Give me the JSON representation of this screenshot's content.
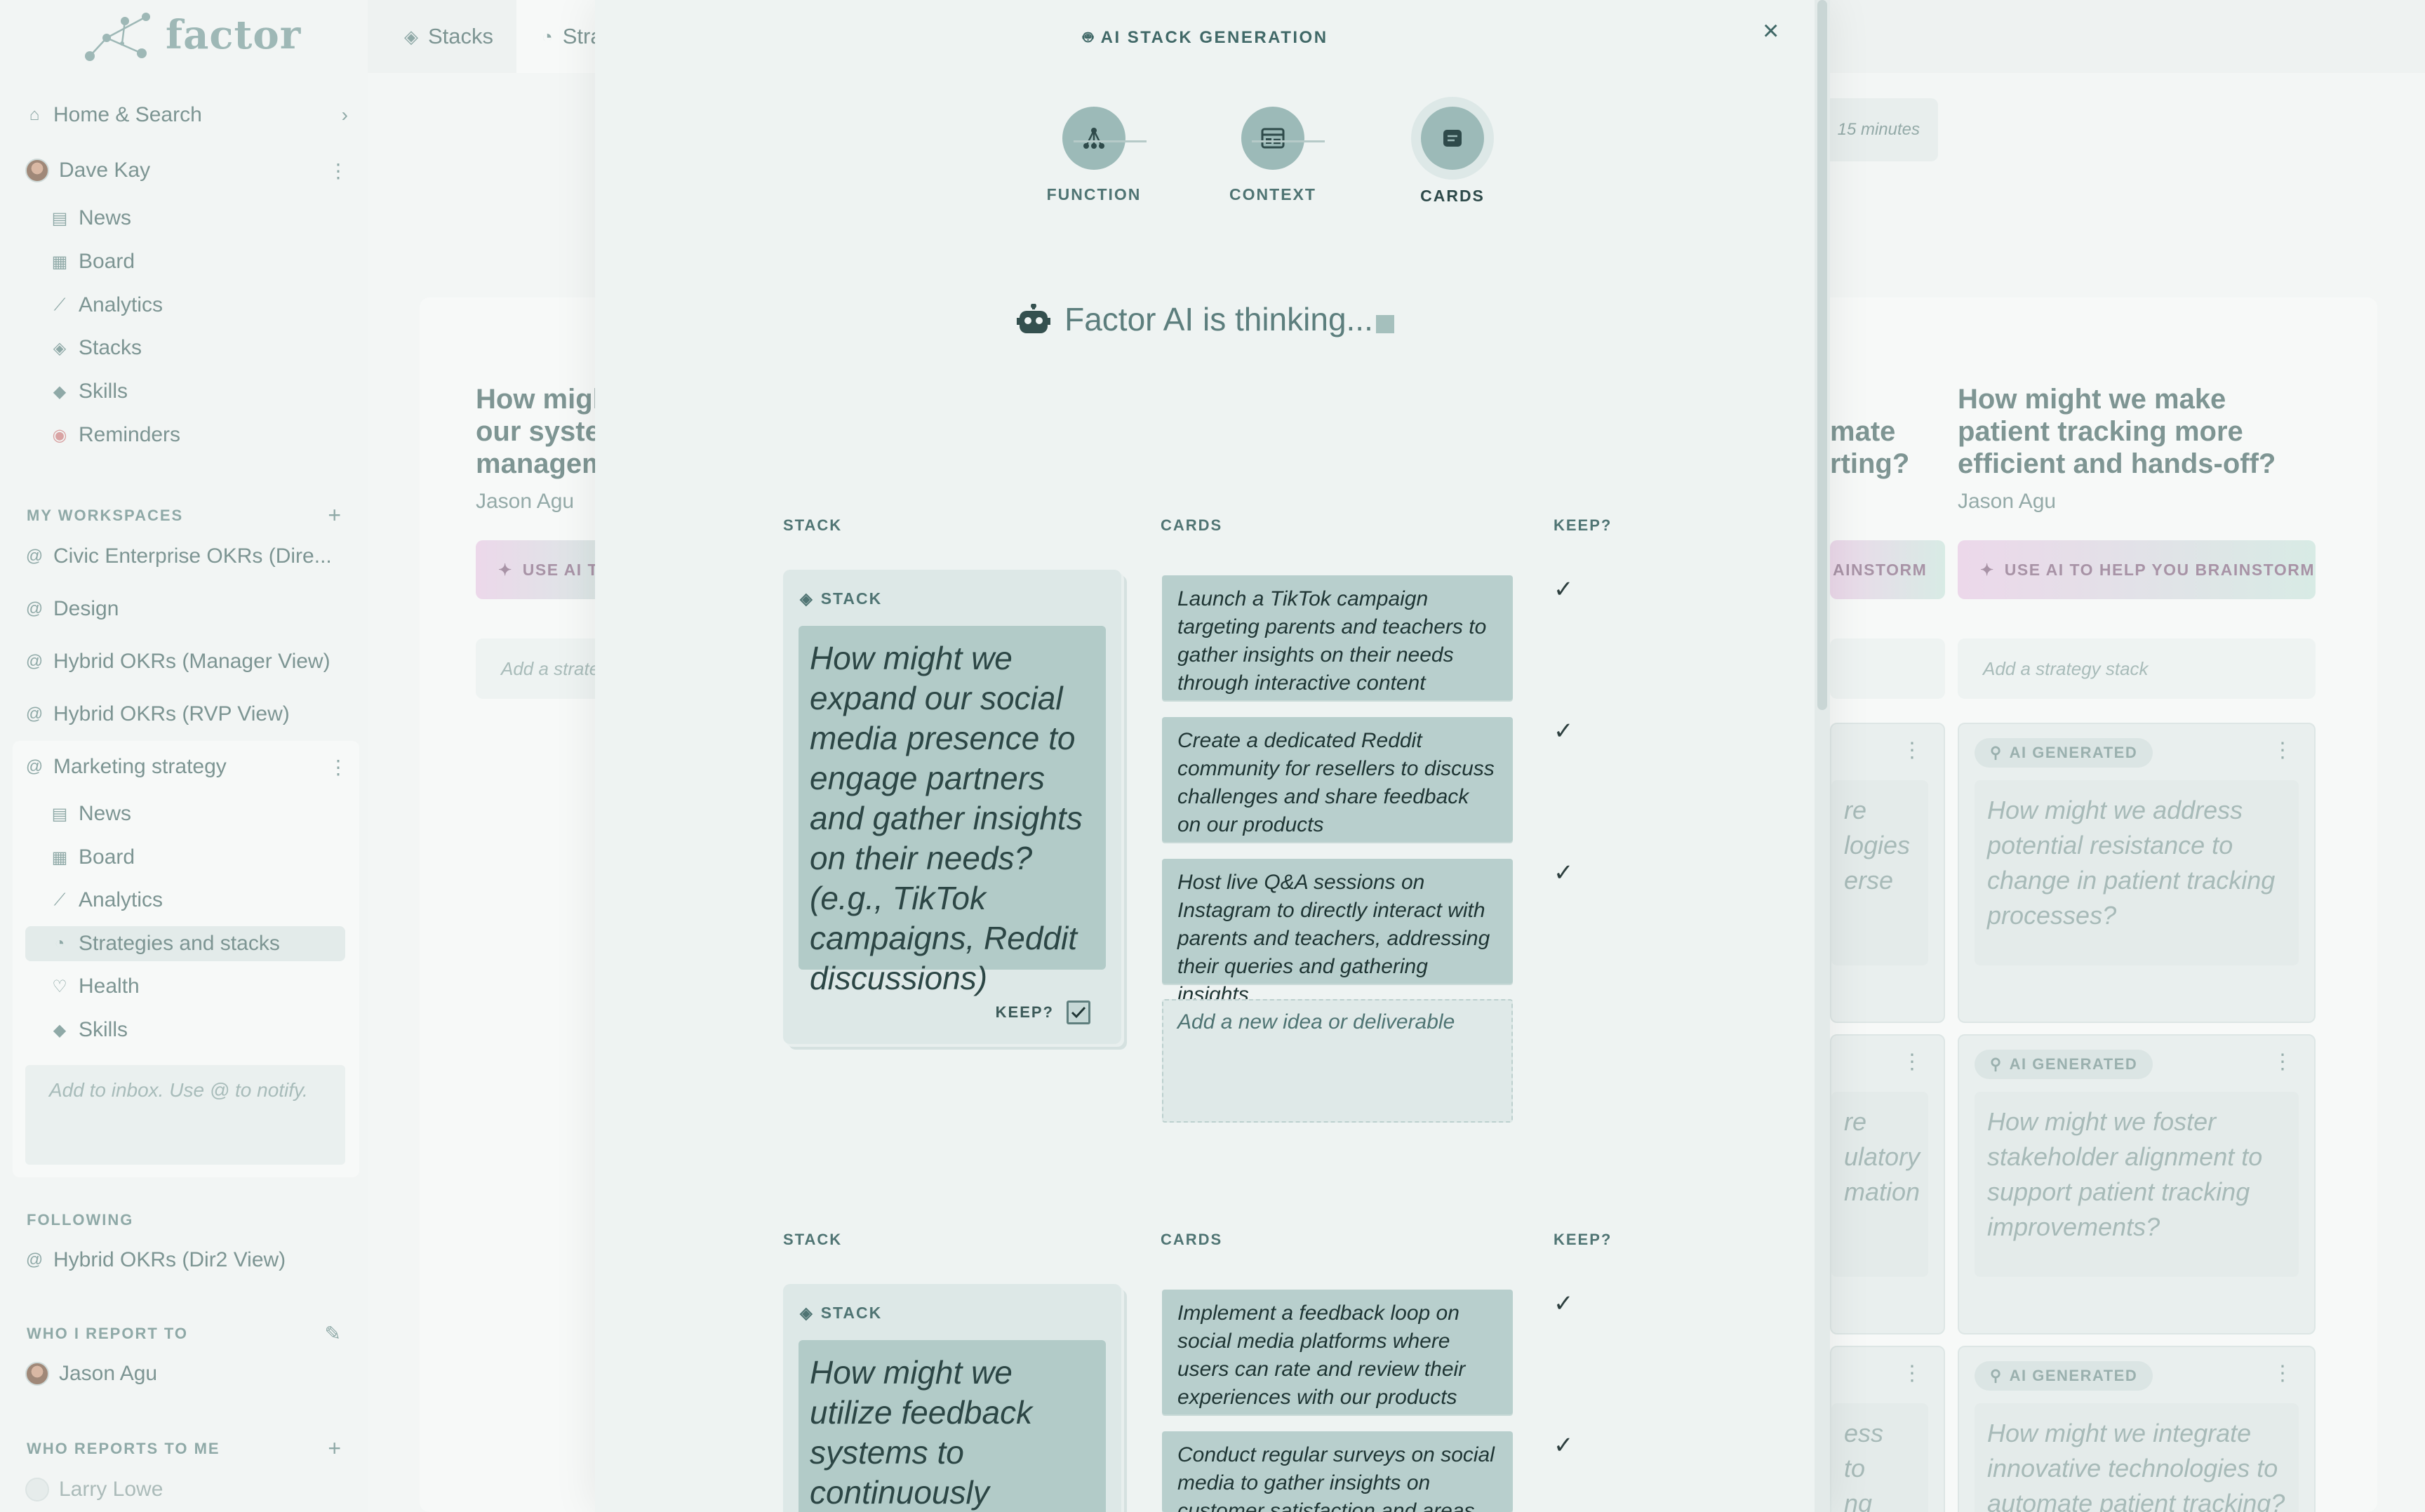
{
  "app": {
    "name": "factor"
  },
  "sidebar": {
    "home": "Home & Search",
    "user": "Dave Kay",
    "user_items": [
      "News",
      "Board",
      "Analytics",
      "Stacks",
      "Skills",
      "Reminders"
    ],
    "my_workspaces_label": "MY WORKSPACES",
    "workspaces": [
      "Civic Enterprise OKRs (Dire...",
      "Design",
      "Hybrid OKRs (Manager View)",
      "Hybrid OKRs (RVP View)",
      "Marketing strategy"
    ],
    "workspace_items": [
      "News",
      "Board",
      "Analytics",
      "Strategies and stacks",
      "Health",
      "Skills"
    ],
    "inbox_placeholder": "Add to inbox. Use @ to notify.",
    "following_label": "FOLLOWING",
    "following": [
      "Hybrid OKRs (Dir2 View)"
    ],
    "report_to_label": "WHO I REPORT TO",
    "report_to": [
      "Jason Agu"
    ],
    "reports_label": "WHO REPORTS TO ME",
    "reports": [
      "Larry Lowe"
    ]
  },
  "tabs": [
    "Stacks",
    "Stra"
  ],
  "background": {
    "time_chip": "15 minutes",
    "columns": [
      {
        "title_lines": [
          "How migh",
          "our syster",
          "managem"
        ],
        "owner": "Jason Agu",
        "ai_button": "USE AI T",
        "add": "Add a strate"
      },
      {
        "title_lines": [
          "mate",
          "rting?"
        ],
        "ai_button": "AINSTORM",
        "cards": [
          "re\nlogies\nerse",
          "re\nulatory\nmation",
          "ess\nto\nng"
        ]
      },
      {
        "title_lines": [
          "How might we make",
          "patient tracking more",
          "efficient and hands-off?"
        ],
        "owner": "Jason Agu",
        "ai_button": "USE AI TO HELP YOU BRAINSTORM",
        "add": "Add a strategy stack",
        "cards": [
          {
            "badge": "AI GENERATED",
            "text": "How might we address potential resistance to change in patient tracking processes?"
          },
          {
            "badge": "AI GENERATED",
            "text": "How might we foster stakeholder alignment to support patient tracking improvements?"
          },
          {
            "badge": "AI GENERATED",
            "text": "How might we integrate innovative technologies to automate patient tracking?"
          }
        ]
      }
    ]
  },
  "modal": {
    "title": "AI STACK GENERATION",
    "close": "×",
    "steps": [
      "FUNCTION",
      "CONTEXT",
      "CARDS"
    ],
    "thinking": "Factor AI is thinking...",
    "col_stack": "STACK",
    "col_cards": "CARDS",
    "col_keep": "KEEP?",
    "stack_label": "STACK",
    "keep_label": "KEEP?",
    "add_idea": "Add a new idea or deliverable",
    "groups": [
      {
        "question": "How might we expand our social media presence to engage partners and gather insights on their needs? (e.g., TikTok campaigns, Reddit discussions)",
        "cards": [
          "Launch a TikTok campaign targeting parents and teachers to gather insights on their needs through interactive content",
          "Create a dedicated Reddit community for resellers to discuss challenges and share feedback on our products",
          "Host live Q&A sessions on Instagram to directly interact with parents and teachers, addressing their queries and gathering insights"
        ]
      },
      {
        "question": "How might we utilize feedback systems to continuously improve user experience and",
        "cards": [
          "Implement a feedback loop on social media platforms where users can rate and review their experiences with our products",
          "Conduct regular surveys on social media to gather insights on customer satisfaction and areas for"
        ]
      }
    ]
  },
  "colors": {
    "accent": "#9cbab8",
    "card": "#b8cfcd",
    "text_dark": "#2c4645"
  }
}
